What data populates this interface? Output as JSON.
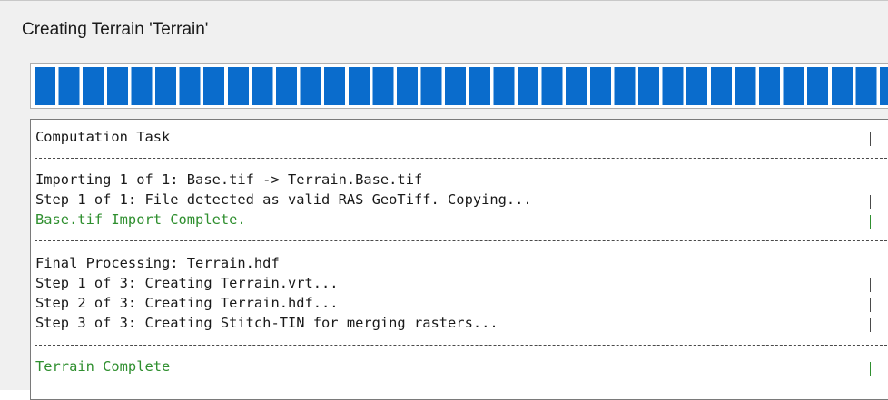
{
  "window": {
    "title": "Creating Terrain 'Terrain'"
  },
  "progress": {
    "percent": 100,
    "color": "#0a6ccc"
  },
  "log": {
    "header": "Computation Task",
    "import": {
      "title": "Importing 1 of 1: Base.tif -> Terrain.Base.tif",
      "step": "Step 1 of 1: File detected as valid RAS GeoTiff. Copying...",
      "complete": "Base.tif Import Complete."
    },
    "final": {
      "title": "Final Processing: Terrain.hdf",
      "steps": [
        "Step 1 of 3: Creating Terrain.vrt...",
        "Step 2 of 3: Creating Terrain.hdf...",
        "Step 3 of 3: Creating Stitch-TIN for merging rasters..."
      ]
    },
    "footer": "Terrain Complete",
    "status_color": "#2f8f2f"
  }
}
